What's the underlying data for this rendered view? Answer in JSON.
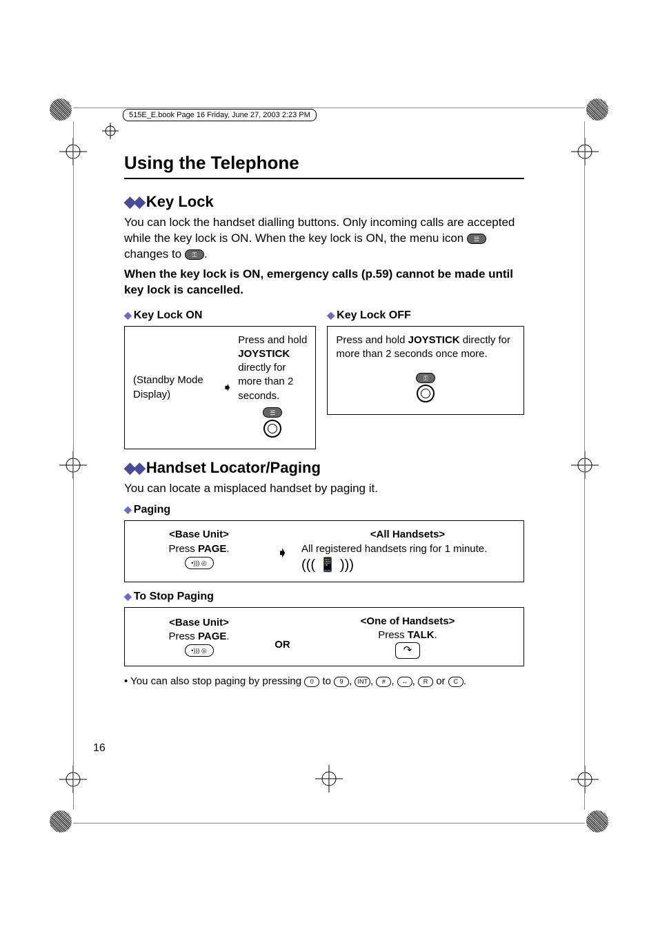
{
  "crop": {
    "filename": "515E_E.book  Page 16  Friday, June 27, 2003  2:23 PM"
  },
  "title": "Using the Telephone",
  "keylock": {
    "heading": "Key Lock",
    "intro1": "You can lock the handset dialling buttons. Only incoming calls are accepted while the key lock is ON. When the key lock is ON, the menu icon",
    "intro1b": "changes to",
    "intro1c": ".",
    "warn": "When the key lock is ON, emergency calls (p.59) cannot be made until key lock is cancelled.",
    "on_label": "Key Lock ON",
    "off_label": "Key Lock OFF",
    "on_left": "(Standby Mode Display)",
    "on_right_a": "Press and hold ",
    "on_right_joy": "JOYSTICK",
    "on_right_b": " directly for more than 2 seconds.",
    "off_a": "Press and hold ",
    "off_joy": "JOYSTICK",
    "off_b": " directly for more than 2 seconds once more."
  },
  "paging": {
    "heading": "Handset Locator/Paging",
    "intro": "You can locate a misplaced handset by paging it.",
    "sub1": "Paging",
    "sub2": "To Stop Paging",
    "base_unit": "<Base Unit>",
    "press": "Press ",
    "page": "PAGE",
    "all_handsets": "<All Handsets>",
    "all_text": "All registered handsets ring for 1 minute.",
    "one_handset": "<One of Handsets>",
    "talk": "TALK",
    "or": "OR",
    "footnote_a": "You can also stop paging by pressing ",
    "footnote_b": " to ",
    "footnote_c": ", ",
    "footnote_d": " or ",
    "footnote_e": "."
  },
  "icons": {
    "menu": "☰",
    "lock": "⚿",
    "zero": "0",
    "nine": "9",
    "int": "INT",
    "hash": "#",
    "arrow2": "↔",
    "r": "R",
    "c": "C",
    "page_btn": "•))) ◎"
  },
  "page_num": "16"
}
